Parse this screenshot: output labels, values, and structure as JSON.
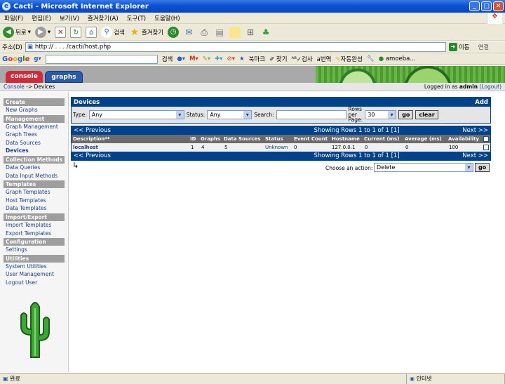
{
  "window": {
    "title": "Cacti - Microsoft Internet Explorer"
  },
  "menu": [
    "파일(F)",
    "편집(E)",
    "보기(V)",
    "즐겨찾기(A)",
    "도구(T)",
    "도움말(H)"
  ],
  "toolbar": {
    "back": "뒤로",
    "search": "검색",
    "favorites": "즐겨찾기"
  },
  "address": {
    "label": "주소(D)",
    "url": "http://  .   .  .  /cacti/host.php",
    "go": "이동",
    "links": "연결"
  },
  "google_bar": {
    "brand": "Google",
    "search": "검색",
    "bookmarks": "북마크",
    "find": "찾기",
    "check": "검사",
    "translate": "번역",
    "autocomplete": "자동완성",
    "user": "amoeba..."
  },
  "tabs": {
    "console": "console",
    "graphs": "graphs"
  },
  "breadcrumb": {
    "root": "Console",
    "sep": " -> ",
    "current": "Devices",
    "login_prefix": "Logged in as ",
    "user": "admin",
    "logout": "(Logout)"
  },
  "sidebar": [
    {
      "type": "sec",
      "label": "Create"
    },
    {
      "type": "item",
      "label": "New Graphs"
    },
    {
      "type": "sec",
      "label": "Management"
    },
    {
      "type": "item",
      "label": "Graph Management"
    },
    {
      "type": "item",
      "label": "Graph Trees"
    },
    {
      "type": "item",
      "label": "Data Sources"
    },
    {
      "type": "item",
      "label": "Devices",
      "active": true
    },
    {
      "type": "sec",
      "label": "Collection Methods"
    },
    {
      "type": "item",
      "label": "Data Queries"
    },
    {
      "type": "item",
      "label": "Data Input Methods"
    },
    {
      "type": "sec",
      "label": "Templates"
    },
    {
      "type": "item",
      "label": "Graph Templates"
    },
    {
      "type": "item",
      "label": "Host Templates"
    },
    {
      "type": "item",
      "label": "Data Templates"
    },
    {
      "type": "sec",
      "label": "Import/Export"
    },
    {
      "type": "item",
      "label": "Import Templates"
    },
    {
      "type": "item",
      "label": "Export Templates"
    },
    {
      "type": "sec",
      "label": "Configuration"
    },
    {
      "type": "item",
      "label": "Settings"
    },
    {
      "type": "sec",
      "label": "Utilities"
    },
    {
      "type": "item",
      "label": "System Utilities"
    },
    {
      "type": "item",
      "label": "User Management"
    },
    {
      "type": "item",
      "label": "Logout User"
    }
  ],
  "devices": {
    "title": "Devices",
    "add": "Add",
    "filter": {
      "type_label": "Type:",
      "type_value": "Any",
      "status_label": "Status:",
      "status_value": "Any",
      "search_label": "Search:",
      "rows_label_1": "Rows",
      "rows_label_2": "per",
      "rows_label_3": "Page:",
      "rows_value": "30",
      "go": "go",
      "clear": "clear"
    },
    "nav": {
      "prev": "<< Previous",
      "showing": "Showing Rows 1 to 1 of 1 [1]",
      "next": "Next >>"
    },
    "columns": [
      "Description**",
      "ID",
      "Graphs",
      "Data Sources",
      "Status",
      "Event Count",
      "Hostname",
      "Current (ms)",
      "Average (ms)",
      "Availability"
    ],
    "rows": [
      {
        "description": "localhost",
        "id": "1",
        "graphs": "4",
        "data_sources": "5",
        "status": "Unknown",
        "event_count": "0",
        "hostname": "127.0.0.1",
        "current": "0",
        "average": "0",
        "availability": "100"
      }
    ],
    "action": {
      "label": "Choose an action:",
      "value": "Delete",
      "go": "go"
    }
  },
  "statusbar": {
    "left": "완료",
    "zone": "인터넷"
  },
  "colors": {
    "cacti_blue": "#00438c",
    "console_tab": "#d32a3a",
    "graphs_tab": "#2a5aad",
    "xp_title": "#0a52d3"
  }
}
